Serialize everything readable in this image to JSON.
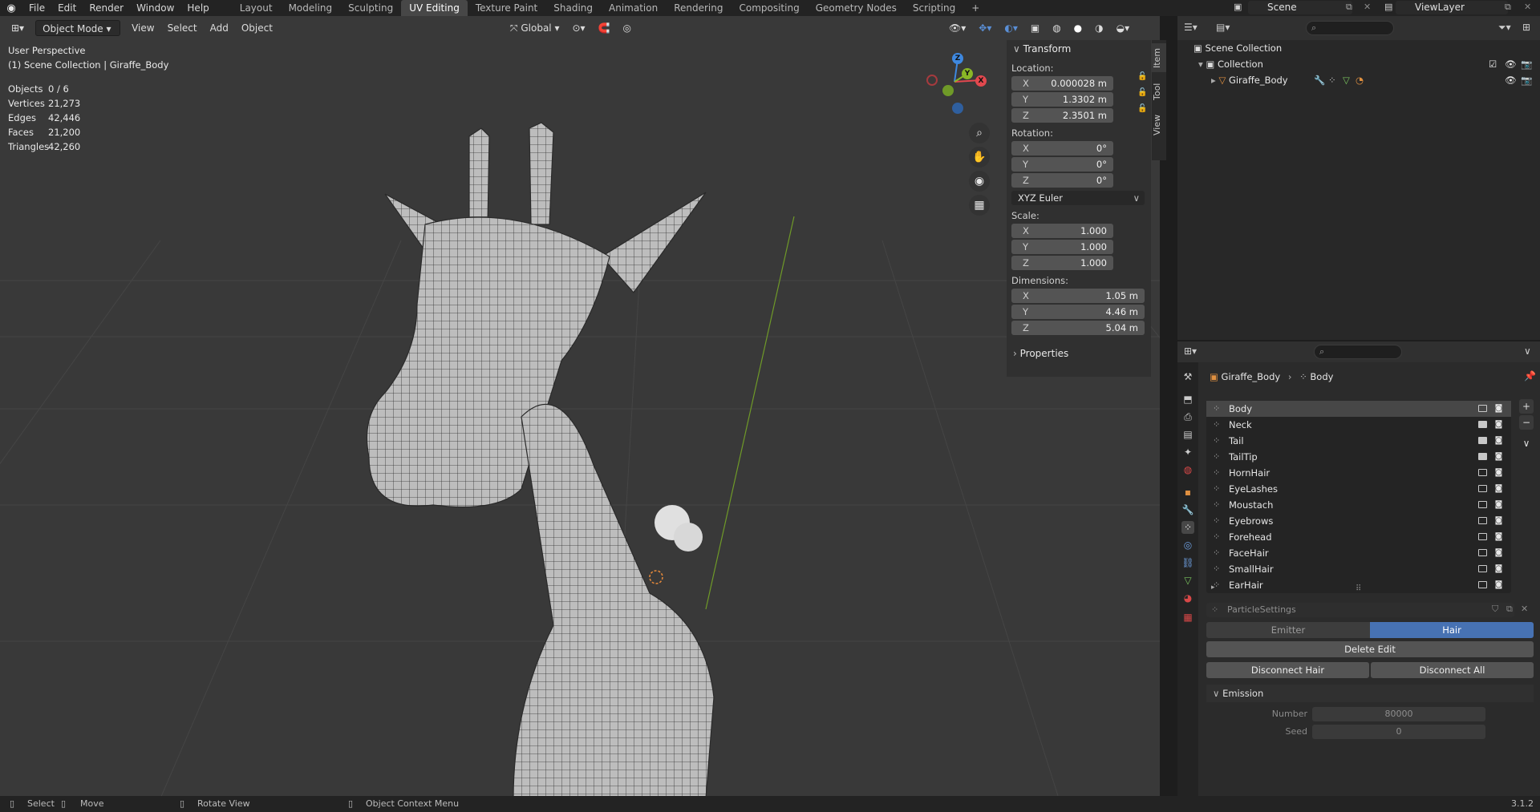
{
  "topbar": {
    "menus": [
      "File",
      "Edit",
      "Render",
      "Window",
      "Help"
    ],
    "workspaces": [
      "Layout",
      "Modeling",
      "Sculpting",
      "UV Editing",
      "Texture Paint",
      "Shading",
      "Animation",
      "Rendering",
      "Compositing",
      "Geometry Nodes",
      "Scripting"
    ],
    "active_workspace": "UV Editing",
    "add_tab": "+",
    "scene": "Scene",
    "view_layer": "ViewLayer"
  },
  "viewport": {
    "mode": "Object Mode",
    "menus": [
      "View",
      "Select",
      "Add",
      "Object"
    ],
    "orientation": "Global",
    "perspective": "User Perspective",
    "collection_info": "(1) Scene Collection | Giraffe_Body",
    "stats": [
      {
        "label": "Objects",
        "value": "0 / 6"
      },
      {
        "label": "Vertices",
        "value": "21,273"
      },
      {
        "label": "Edges",
        "value": "42,446"
      },
      {
        "label": "Faces",
        "value": "21,200"
      },
      {
        "label": "Triangles",
        "value": "42,260"
      }
    ],
    "gizmo": {
      "x": "X",
      "y": "Y",
      "z": "Z"
    }
  },
  "npanel": {
    "tabs": [
      "Item",
      "Tool",
      "View"
    ],
    "transform_title": "Transform",
    "location_label": "Location:",
    "location": [
      {
        "axis": "X",
        "value": "0.000028 m"
      },
      {
        "axis": "Y",
        "value": "1.3302 m"
      },
      {
        "axis": "Z",
        "value": "2.3501 m"
      }
    ],
    "rotation_label": "Rotation:",
    "rotation": [
      {
        "axis": "X",
        "value": "0°"
      },
      {
        "axis": "Y",
        "value": "0°"
      },
      {
        "axis": "Z",
        "value": "0°"
      }
    ],
    "rotation_mode": "XYZ Euler",
    "scale_label": "Scale:",
    "scale": [
      {
        "axis": "X",
        "value": "1.000"
      },
      {
        "axis": "Y",
        "value": "1.000"
      },
      {
        "axis": "Z",
        "value": "1.000"
      }
    ],
    "dimensions_label": "Dimensions:",
    "dimensions": [
      {
        "axis": "X",
        "value": "1.05 m"
      },
      {
        "axis": "Y",
        "value": "4.46 m"
      },
      {
        "axis": "Z",
        "value": "5.04 m"
      }
    ],
    "properties_title": "Properties"
  },
  "outliner": {
    "scene_collection": "Scene Collection",
    "collection": "Collection",
    "object": "Giraffe_Body"
  },
  "properties": {
    "breadcrumb_object": "Giraffe_Body",
    "breadcrumb_system": "Body",
    "particle_systems": [
      "Body",
      "Neck",
      "Tail",
      "TailTip",
      "HornHair",
      "EyeLashes",
      "Moustach",
      "Eyebrows",
      "Forehead",
      "FaceHair",
      "SmallHair",
      "EarHair"
    ],
    "selected_system": "Body",
    "settings_name": "ParticleSettings",
    "type_emitter": "Emitter",
    "type_hair": "Hair",
    "delete_edit": "Delete Edit",
    "disconnect_hair": "Disconnect Hair",
    "disconnect_all": "Disconnect All",
    "emission_title": "Emission",
    "number_label": "Number",
    "number_value": "80000",
    "seed_label": "Seed",
    "seed_value": "0"
  },
  "statusbar": {
    "select": "Select",
    "move": "Move",
    "rotate": "Rotate View",
    "context": "Object Context Menu",
    "version": "3.1.2"
  },
  "colors": {
    "accent_blue": "#4772b3",
    "x_axis": "#e2484e",
    "y_axis": "#8ab726",
    "z_axis": "#3e88e0"
  }
}
